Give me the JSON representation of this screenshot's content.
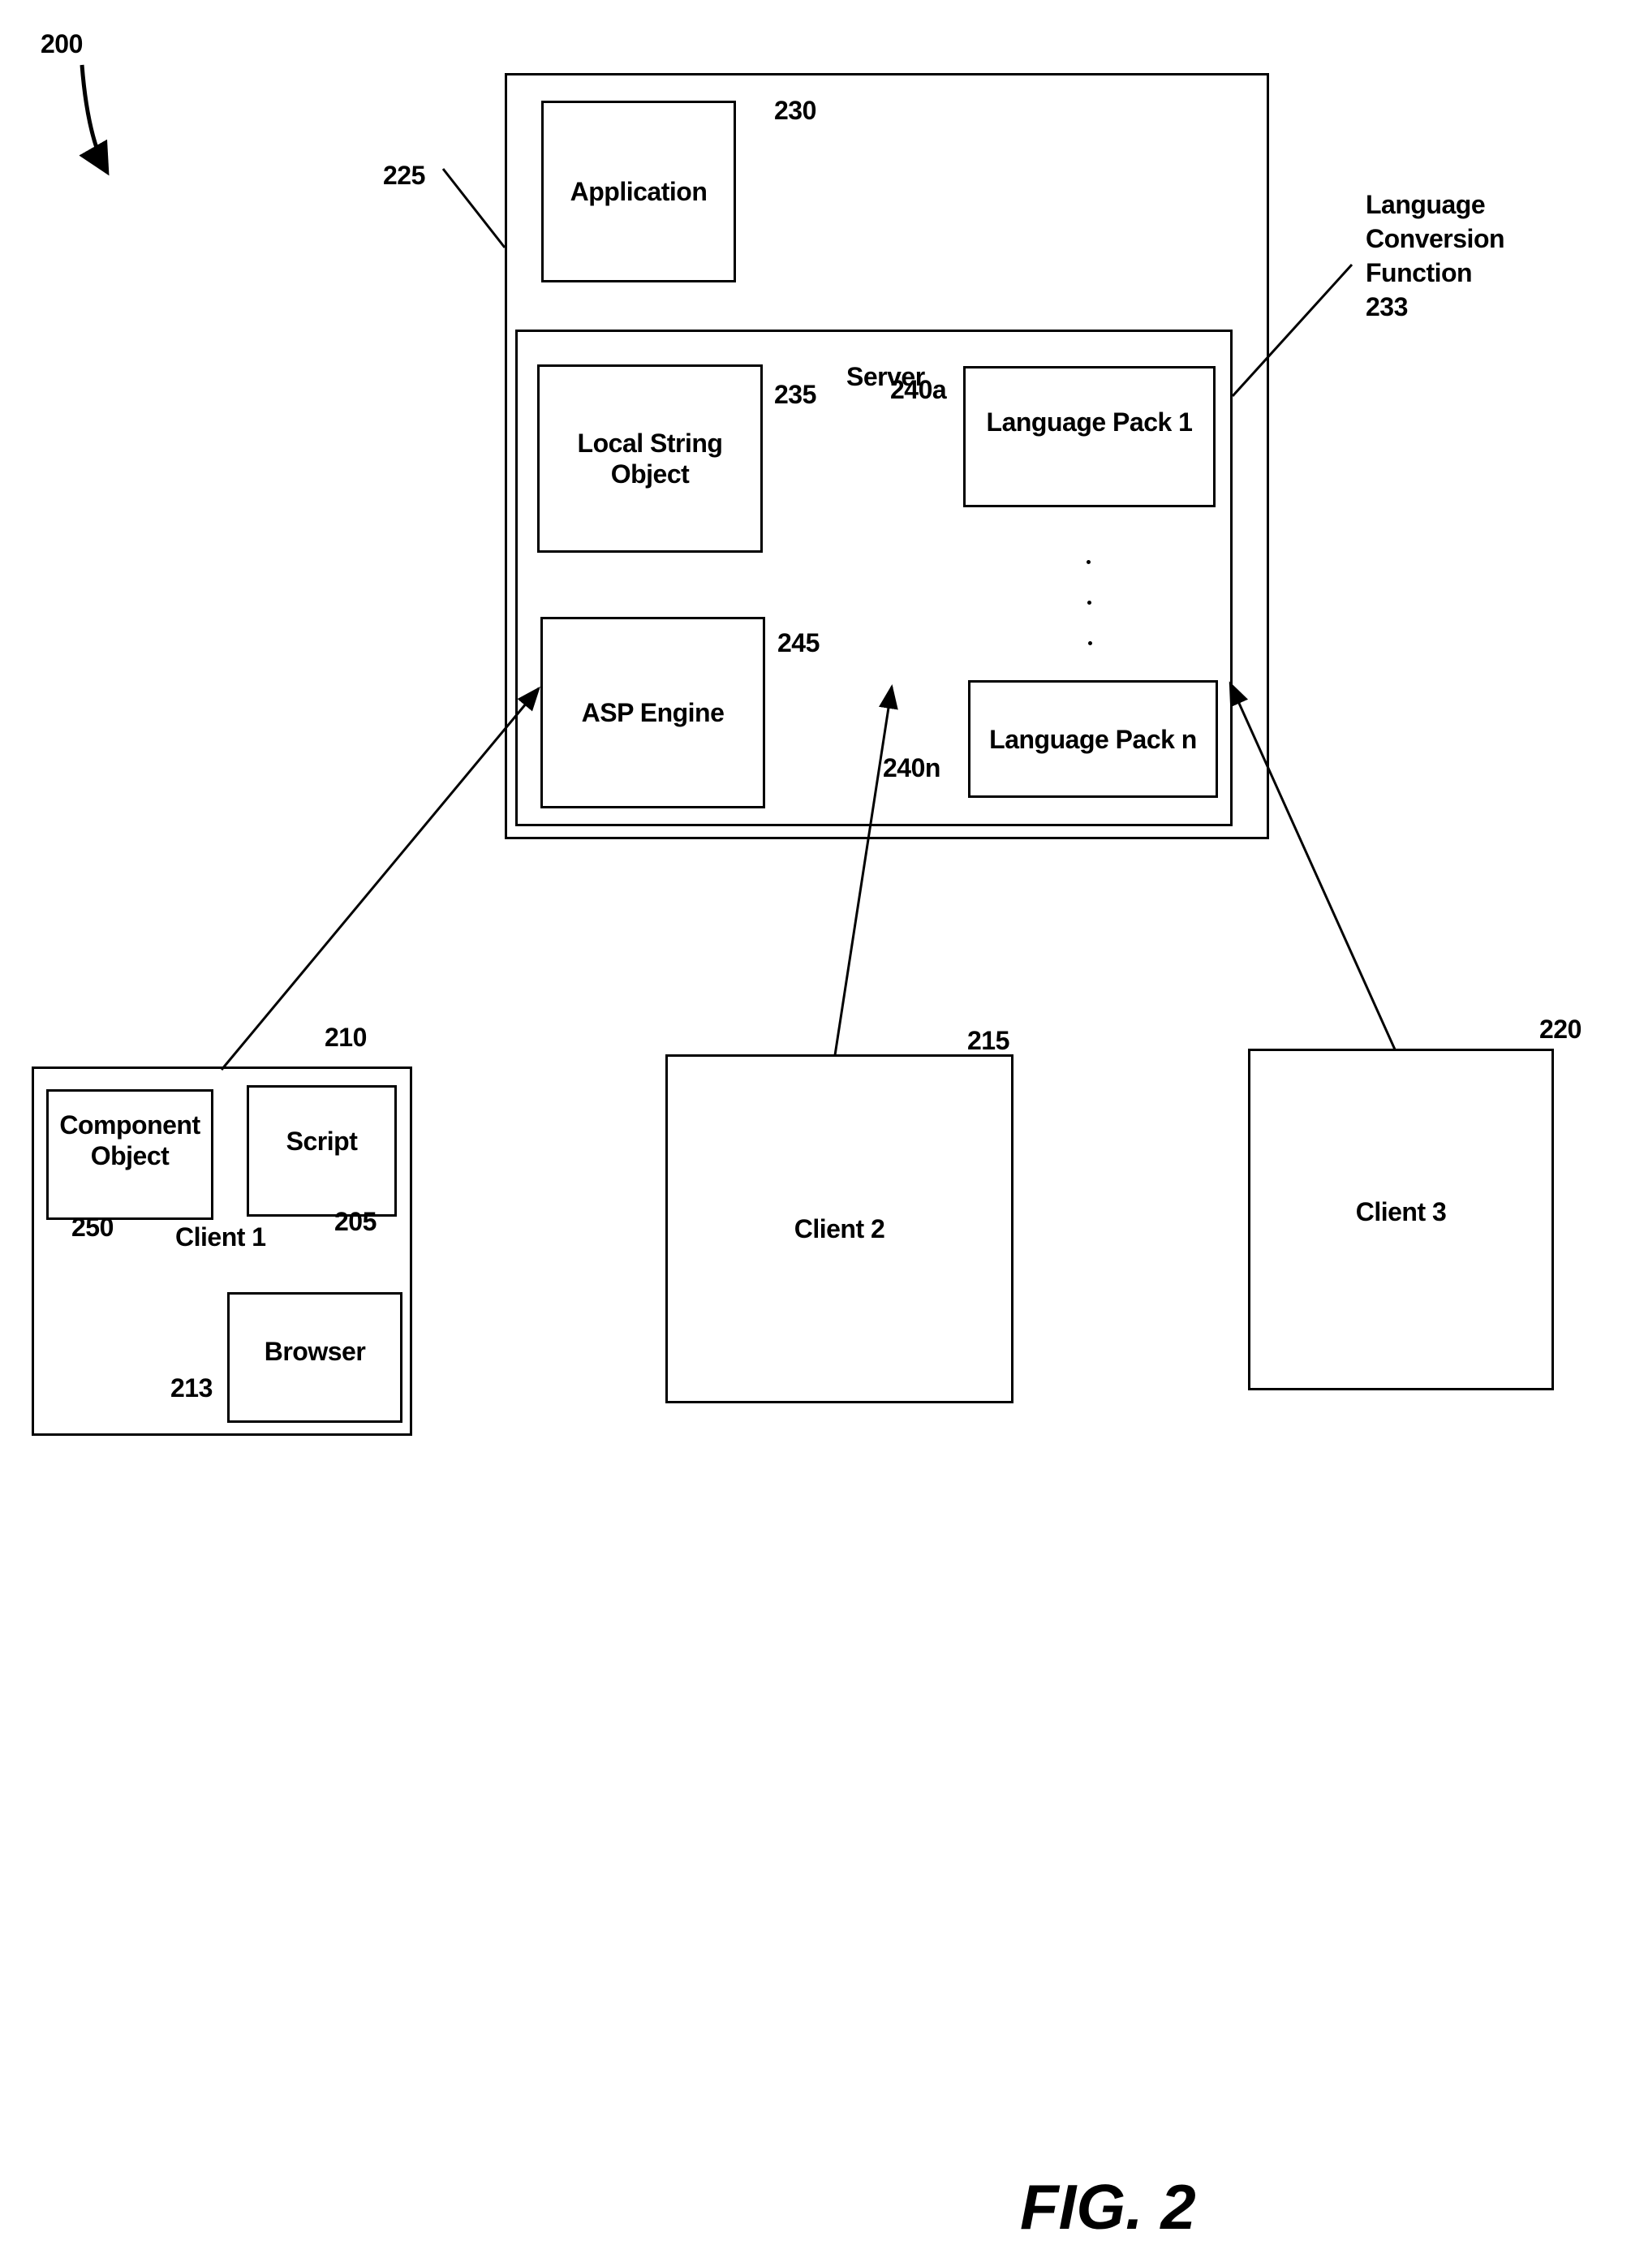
{
  "figure": {
    "label": "FIG. 2",
    "ref": "200"
  },
  "server_system": {
    "ref": "225",
    "application": {
      "label": "Application",
      "ref": "230"
    },
    "server": {
      "label": "Server",
      "local_string_object": {
        "label": "Local String Object",
        "ref": "235"
      },
      "asp_engine": {
        "label": "ASP Engine",
        "ref": "245"
      },
      "language_packs": [
        {
          "label": "Language Pack 1",
          "ref": "240a"
        },
        {
          "label": "Language Pack n",
          "ref": "240n"
        }
      ],
      "ellipsis": "· · ·"
    },
    "language_conversion_function": {
      "lines": [
        "Language",
        "Conversion",
        "Function"
      ],
      "ref": "233"
    }
  },
  "clients": [
    {
      "label": "Client 1",
      "ref": "210",
      "component_object": {
        "label": "Component Object",
        "ref": "250"
      },
      "script": {
        "label": "Script",
        "ref": "205"
      },
      "browser": {
        "label": "Browser",
        "ref": "213"
      }
    },
    {
      "label": "Client 2",
      "ref": "215"
    },
    {
      "label": "Client 3",
      "ref": "220"
    }
  ]
}
